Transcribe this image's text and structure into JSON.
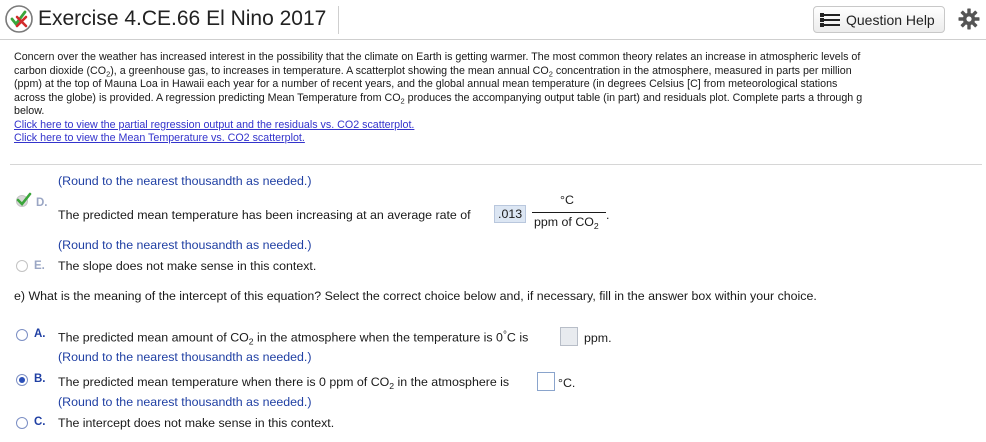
{
  "header": {
    "title": "Exercise 4.CE.66 El Nino 2017",
    "help_label": "Question Help"
  },
  "intro": {
    "p1": "Concern over the weather has increased interest in the possibility that the climate on Earth is getting warmer. The most common theory relates an increase in atmospheric levels of",
    "p2a": "carbon dioxide (CO",
    "p2b": "), a greenhouse gas, to increases in temperature. A scatterplot showing the mean annual CO",
    "p2c": " concentration in the atmosphere, measured in parts per million",
    "p3": "(ppm) at the top of Mauna Loa in Hawaii each year for a number of recent years, and the global annual mean temperature (in degrees Celsius [C] from meteorological stations",
    "p4a": "across the globe) is provided. A regression predicting Mean Temperature from CO",
    "p4b": " produces the accompanying output table (in part) and residuals plot. Complete parts a through g",
    "p5": "below.",
    "sub2": "2",
    "link1": "Click here to view the partial regression output and the residuals vs. CO2 scatterplot.",
    "link2": "Click here to view the Mean Temperature vs. CO2 scatterplot."
  },
  "partd": {
    "hint_top": "(Round to the nearest thousandth as needed.)",
    "letter": "D.",
    "text": "The predicted mean temperature has been increasing at an average rate of",
    "answer": ".013",
    "unit_num": "°C",
    "unit_den_a": "ppm of CO",
    "unit_den_sub": "2",
    "period": ".",
    "hint": "(Round to the nearest thousandth as needed.)",
    "e_letter": "E.",
    "e_text": "The slope does not make sense in this context."
  },
  "parte": {
    "question": "e) What is the meaning of the intercept of this equation? Select the correct choice below and, if necessary, fill in the answer box within your choice.",
    "a_letter": "A.",
    "a_text_1": "The predicted mean amount of CO",
    "a_sub": "2",
    "a_text_2": " in the atmosphere when the temperature is 0",
    "a_deg": "°",
    "a_text_3": "C is",
    "a_unit": "ppm.",
    "a_hint": "(Round to the nearest thousandth as needed.)",
    "b_letter": "B.",
    "b_text_1": "The predicted mean temperature when there is 0 ppm of CO",
    "b_sub": "2",
    "b_text_2": " in the atmosphere is",
    "b_unit": "°C.",
    "b_hint": "(Round to the nearest thousandth as needed.)",
    "c_letter": "C.",
    "c_text": "The intercept does not make sense in this context.",
    "selected": "B"
  },
  "colors": {
    "accent": "#1f3fa3",
    "link": "#3333cc",
    "answer_bg": "#dce6f3"
  }
}
